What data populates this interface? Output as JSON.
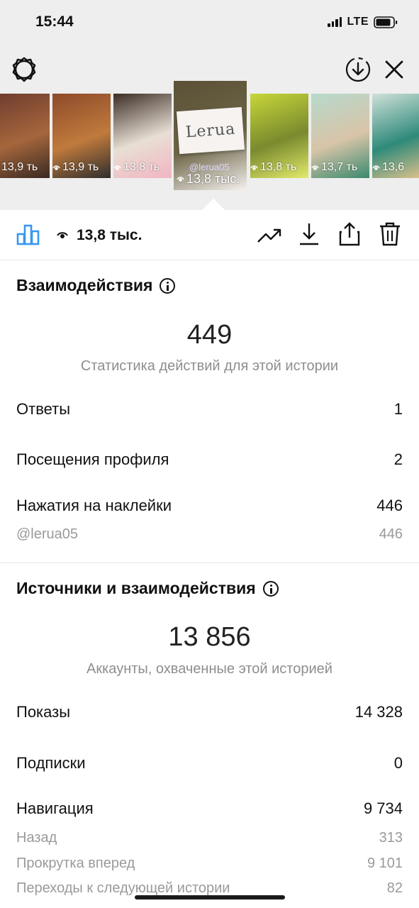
{
  "status_bar": {
    "time": "15:44",
    "network": "LTE"
  },
  "thumbnails": [
    {
      "views": "13,9 ть",
      "colors": [
        "#6d3b2e",
        "#a5663c",
        "#3a2a22"
      ]
    },
    {
      "views": "13,9 ть",
      "colors": [
        "#8d4a2a",
        "#c07a3c",
        "#2e2e2e"
      ]
    },
    {
      "views": "13,8 ть",
      "colors": [
        "#3b2d24",
        "#e8dfd4",
        "#f2b5c2"
      ]
    },
    {
      "views": "13,8 тыс.",
      "handle": "@lerua05",
      "brand": "Lerua",
      "colors": [
        "#5a5036",
        "#6e6648",
        "#f4f1ee"
      ],
      "selected": true
    },
    {
      "views": "13,8 ть",
      "colors": [
        "#c8d63a",
        "#7a8a2e",
        "#e3ea6a"
      ]
    },
    {
      "views": "13,7 ть",
      "colors": [
        "#b7d9cc",
        "#d8c4a8",
        "#3a8a6e"
      ]
    },
    {
      "views": "13,6",
      "colors": [
        "#cfe0d8",
        "#2e8a7a",
        "#e9c48c"
      ]
    }
  ],
  "toolbar": {
    "views": "13,8 тыс."
  },
  "interactions": {
    "title": "Взаимодействия",
    "total": "449",
    "subtitle": "Статистика действий для этой истории",
    "rows": [
      {
        "label": "Ответы",
        "value": "1"
      },
      {
        "label": "Посещения профиля",
        "value": "2"
      },
      {
        "label": "Нажатия на наклейки",
        "value": "446"
      }
    ],
    "sticker": {
      "label": "@lerua05",
      "value": "446"
    }
  },
  "discovery": {
    "title": "Источники и взаимодействия",
    "total": "13 856",
    "subtitle": "Аккаунты, охваченные этой историей",
    "rows": [
      {
        "label": "Показы",
        "value": "14 328"
      },
      {
        "label": "Подписки",
        "value": "0"
      },
      {
        "label": "Навигация",
        "value": "9 734"
      }
    ],
    "nav_rows": [
      {
        "label": "Назад",
        "value": "313"
      },
      {
        "label": "Прокрутка вперед",
        "value": "9 101"
      },
      {
        "label": "Переходы к следующей истории",
        "value": "82"
      }
    ]
  },
  "colors": {
    "accent": "#3897f0",
    "muted": "#8e8e8e",
    "text": "#111111"
  }
}
